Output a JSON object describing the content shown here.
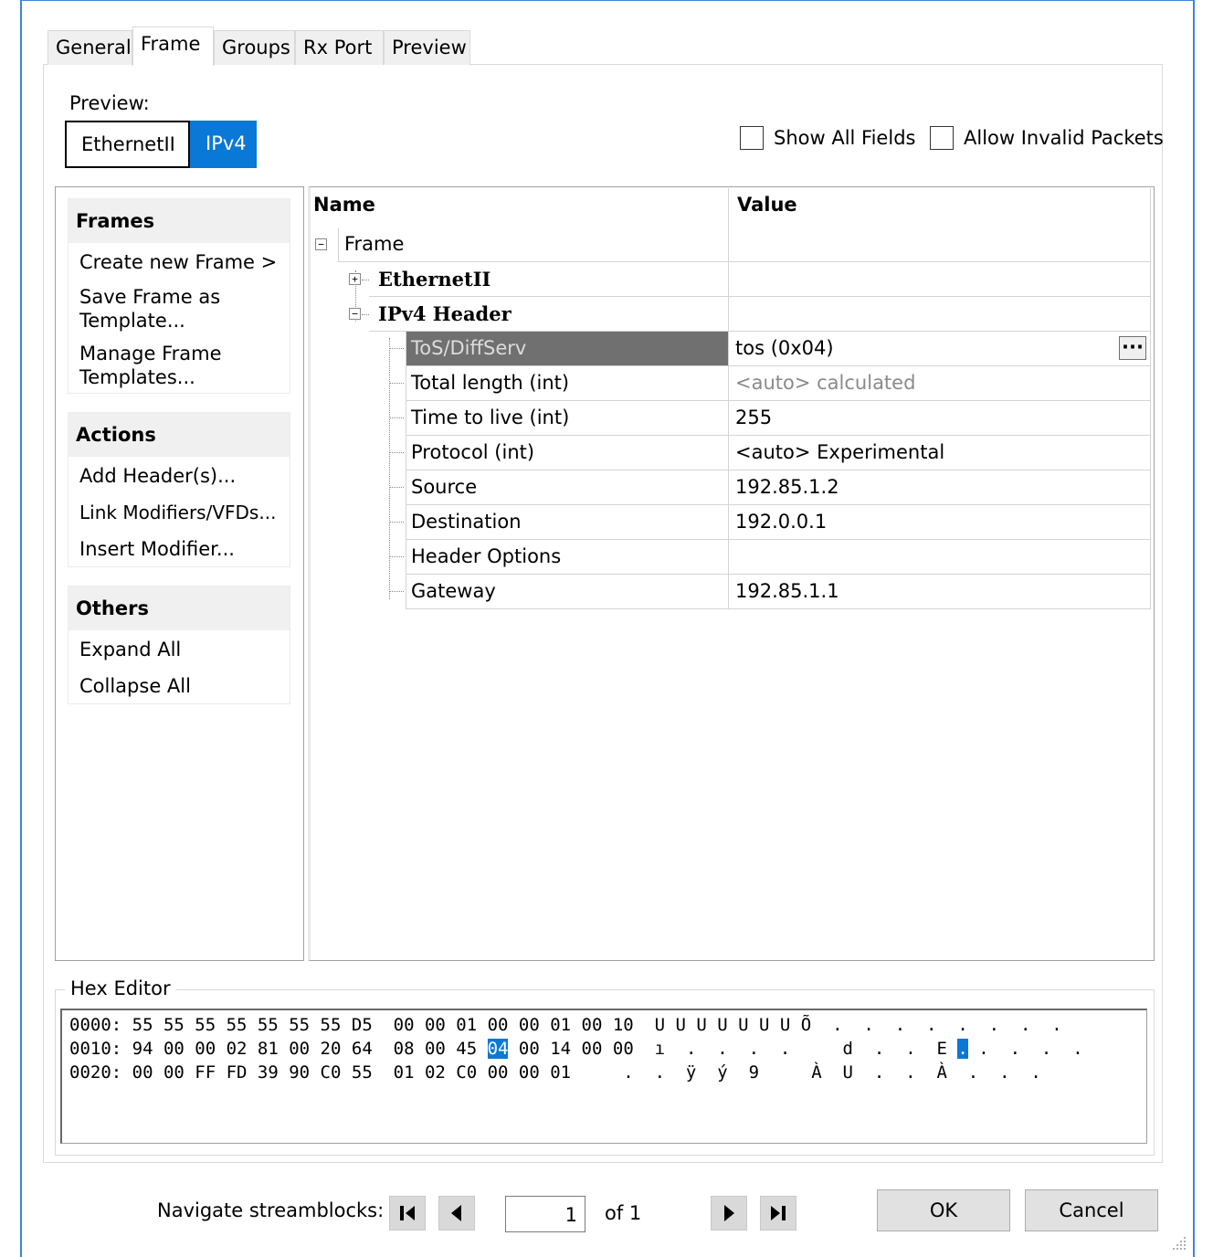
{
  "tabs": [
    "General",
    "Frame",
    "Groups",
    "Rx Port",
    "Preview"
  ],
  "preview": {
    "label": "Preview:",
    "buttons": [
      "EthernetII",
      "IPv4"
    ]
  },
  "options": {
    "show_all_fields": "Show All Fields",
    "allow_invalid": "Allow Invalid Packets"
  },
  "left_panel": {
    "frames": {
      "title": "Frames",
      "items": [
        "Create new Frame >",
        "Save Frame as Template...",
        "Manage Frame Templates..."
      ]
    },
    "actions": {
      "title": "Actions",
      "items": [
        "Add Header(s)...",
        "Link Modifiers/VFDs...",
        "Insert Modifier..."
      ]
    },
    "others": {
      "title": "Others",
      "items": [
        "Expand All",
        "Collapse All"
      ]
    }
  },
  "grid": {
    "columns": {
      "name": "Name",
      "value": "Value"
    },
    "frame_label": "Frame",
    "ethernet_label": "EthernetII",
    "ipv4_label": "IPv4 Header",
    "fields": [
      {
        "name": "ToS/DiffServ",
        "value": "tos (0x04)"
      },
      {
        "name": "Total length (int)",
        "value": "<auto> calculated"
      },
      {
        "name": "Time to live (int)",
        "value": "255"
      },
      {
        "name": "Protocol (int)",
        "value": "<auto> Experimental"
      },
      {
        "name": "Source",
        "value": "192.85.1.2"
      },
      {
        "name": "Destination",
        "value": "192.0.0.1"
      },
      {
        "name": "Header Options",
        "value": ""
      },
      {
        "name": "Gateway",
        "value": "192.85.1.1"
      }
    ],
    "ellipsis": "···"
  },
  "hex_editor": {
    "title": "Hex Editor",
    "lines": [
      {
        "offset": "0000:",
        "bytes_a": "55 55 55 55 55 55 55 D5  00 00 01 00 00 01 00 10",
        "bytes_b": "",
        "selected": "",
        "bytes_c": "",
        "ascii": "U U U U U U U Õ  .  .  .  .  .  .  .  ."
      },
      {
        "offset": "0010:",
        "bytes_a": "94 00 00 02 81 00 20 64  08 00 45 ",
        "selected": "04",
        "bytes_c": " 00 14 00 00",
        "ascii": "ı  .  .  .  .     d  .  .  E",
        "ascii_sel": ".",
        "ascii_tail": " .  .  .  ."
      },
      {
        "offset": "0020:",
        "bytes_a": "00 00 FF FD 39 90 C0 55  01 02 C0 00 00 01",
        "bytes_b": "",
        "selected": "",
        "bytes_c": "",
        "ascii": ".  .  ÿ  ý  9     À  U  .  .  À  .  .  ."
      }
    ]
  },
  "footer": {
    "navigate_label": "Navigate streamblocks:",
    "page_value": "1",
    "of_label": "of 1",
    "ok": "OK",
    "cancel": "Cancel"
  }
}
